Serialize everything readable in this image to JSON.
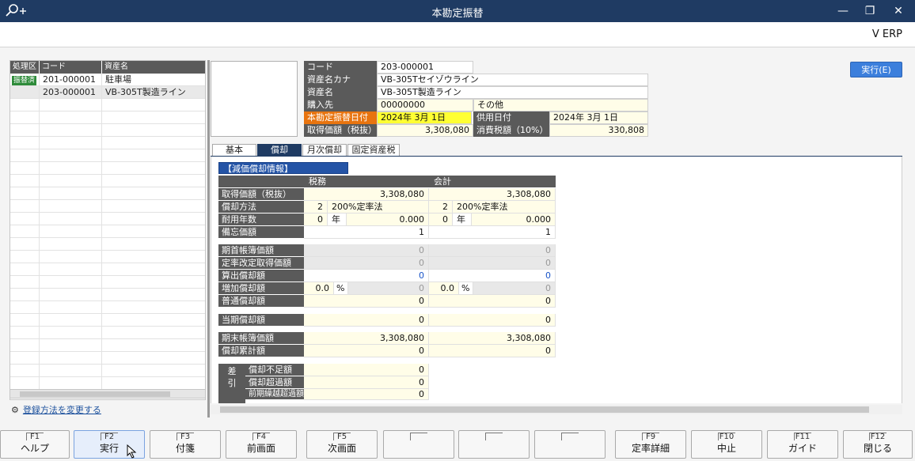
{
  "window": {
    "title": "本勘定振替",
    "brand": "V ERP"
  },
  "list": {
    "headers": [
      "処理区分",
      "コード",
      "資産名"
    ],
    "rows": [
      {
        "status": "振替済",
        "code": "201-000001",
        "name": "駐車場"
      },
      {
        "status": "",
        "code": "203-000001",
        "name": "VB-305T製造ライン"
      }
    ],
    "change_link": "登録方法を変更する"
  },
  "header": {
    "code_label": "コード",
    "code": "203-000001",
    "kana_label": "資産名カナ",
    "kana": "VB-305Tセイゾウライン",
    "name_label": "資産名",
    "name": "VB-305T製造ライン",
    "vendor_label": "購入先",
    "vendor_code": "00000000",
    "vendor_name": "その他",
    "transfer_date_label": "本勘定振替日付",
    "transfer_date": "2024年  3月  1日",
    "use_date_label": "供用日付",
    "use_date": "2024年  3月  1日",
    "acq_label": "取得価額（税抜）",
    "acq": "3,308,080",
    "tax_label": "消費税額（10%）",
    "tax": "330,808",
    "exec_button": "実行(E)"
  },
  "tabs": [
    "基本",
    "償却",
    "月次償却",
    "固定資産税"
  ],
  "depr": {
    "section_title": "【減価償却情報】",
    "col_tax": "税務",
    "col_acc": "会計",
    "acq_label": "取得価額（税抜）",
    "acq_tax": "3,308,080",
    "acq_acc": "3,308,080",
    "method_label": "償却方法",
    "method_no_tax": "2",
    "method_tax": "200%定率法",
    "method_no_acc": "2",
    "method_acc": "200%定率法",
    "life_label": "耐用年数",
    "life_tax": "0",
    "life_acc": "0",
    "year_unit": "年",
    "rate_tax": "0.000",
    "rate_acc": "0.000",
    "memo_label": "備忘価額",
    "memo_tax": "1",
    "memo_acc": "1",
    "open_label": "期首帳簿価額",
    "open_tax": "0",
    "open_acc": "0",
    "revised_label": "定率改定取得価額",
    "revised_tax": "0",
    "revised_acc": "0",
    "calc_label": "算出償却額",
    "calc_tax": "0",
    "calc_acc": "0",
    "add_label": "増加償却額",
    "add_pct_tax": "0.0",
    "add_pct_acc": "0.0",
    "pct_unit": "%",
    "add_tax": "0",
    "add_acc": "0",
    "normal_label": "普通償却額",
    "normal_tax": "0",
    "normal_acc": "0",
    "period_label": "当期償却額",
    "period_tax": "0",
    "period_acc": "0",
    "close_label": "期末帳簿価額",
    "close_tax": "3,308,080",
    "close_acc": "3,308,080",
    "accum_label": "償却累計額",
    "accum_tax": "0",
    "accum_acc": "0",
    "diff_label": "差引",
    "short_label": "償却不足額",
    "short_val": "0",
    "over_label": "償却超過額",
    "over_val": "0",
    "carry_label": "前期繰越超過額",
    "carry_val": "0"
  },
  "fkeys": [
    {
      "key": "F1",
      "label": "ヘルプ"
    },
    {
      "key": "F2",
      "label": "実行"
    },
    {
      "key": "F3",
      "label": "付箋"
    },
    {
      "key": "F4",
      "label": "前画面"
    },
    {
      "key": "F5",
      "label": "次画面"
    },
    {
      "key": "",
      "label": ""
    },
    {
      "key": "",
      "label": ""
    },
    {
      "key": "",
      "label": ""
    },
    {
      "key": "F9",
      "label": "定率詳細"
    },
    {
      "key": "F10",
      "label": "中止"
    },
    {
      "key": "F11",
      "label": "ガイド"
    },
    {
      "key": "F12",
      "label": "閉じる"
    }
  ]
}
